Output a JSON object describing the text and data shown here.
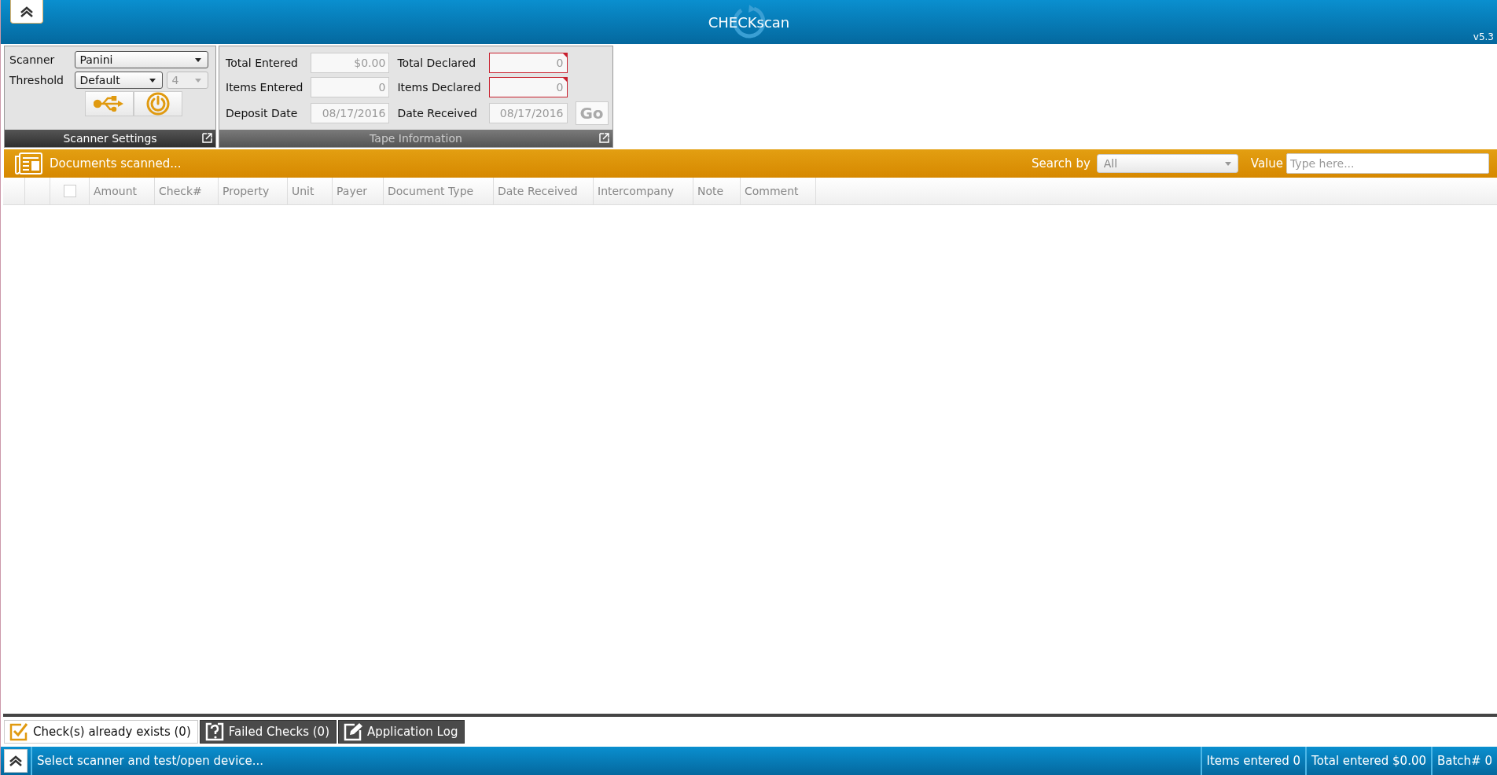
{
  "header": {
    "title": "CHECKscan",
    "version": "v5.3"
  },
  "scanner_settings": {
    "title": "Scanner Settings",
    "scanner": {
      "label": "Scanner",
      "value": "Panini"
    },
    "threshold": {
      "label": "Threshold",
      "value": "Default",
      "level_value": "4",
      "level_disabled": true
    }
  },
  "tape_information": {
    "title": "Tape Information",
    "fields": [
      {
        "label": "Total Entered",
        "value": "$0.00",
        "required": false
      },
      {
        "label": "Total Declared",
        "value": "0",
        "required": true
      },
      {
        "label": "Items Entered",
        "value": "0",
        "required": false
      },
      {
        "label": "Items Declared",
        "value": "0",
        "required": true
      },
      {
        "label": "Deposit Date",
        "value": "08/17/2016",
        "required": false
      },
      {
        "label": "Date Received",
        "value": "08/17/2016",
        "required": false
      }
    ],
    "go_button": {
      "label": "Go",
      "disabled": true
    }
  },
  "documents": {
    "title": "Documents scanned...",
    "search_by": {
      "label": "Search by",
      "value": "All"
    },
    "value_field": {
      "label": "Value",
      "placeholder": "Type here..."
    }
  },
  "table": {
    "select_all_checked": false,
    "columns": [
      "Amount",
      "Check#",
      "Property",
      "Unit",
      "Payer",
      "Document Type",
      "Date Received",
      "Intercompany",
      "Note",
      "Comment"
    ]
  },
  "tabs": [
    {
      "label": "Check(s) already exists (0)",
      "selected": true,
      "kind": "check"
    },
    {
      "label": "Failed Checks (0)",
      "selected": false,
      "kind": "question"
    },
    {
      "label": "Application Log",
      "selected": false,
      "kind": "edit"
    }
  ],
  "status_bar": {
    "message": "Select scanner and test/open device...",
    "items": [
      "Items entered 0",
      "Total entered $0.00",
      "Batch# 0"
    ]
  }
}
